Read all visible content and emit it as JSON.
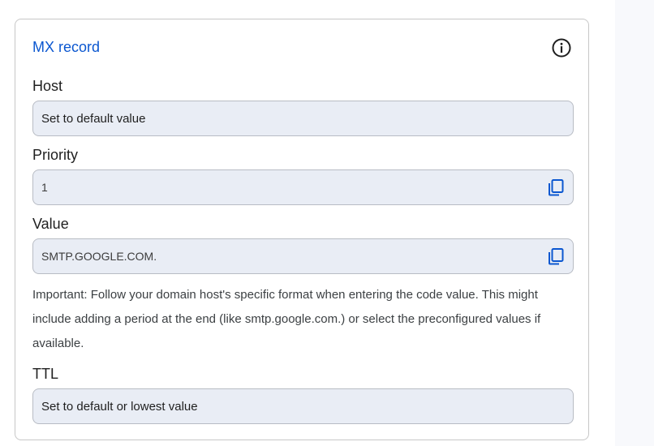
{
  "card": {
    "title": "MX record",
    "info_icon": "info-icon"
  },
  "host": {
    "label": "Host",
    "value": "Set to default value"
  },
  "priority": {
    "label": "Priority",
    "value": "1",
    "copy_icon": "copy-icon"
  },
  "value_field": {
    "label": "Value",
    "value": "SMTP.GOOGLE.COM.",
    "copy_icon": "copy-icon"
  },
  "note": "Important: Follow your domain host's specific format when entering the code value. This might include adding a period at the end (like smtp.google.com.) or select the preconfigured values if available.",
  "ttl": {
    "label": "TTL",
    "value": "Set to default or lowest value"
  },
  "colors": {
    "accent": "#0b57d0",
    "field_bg": "#e9edf5",
    "field_border": "#b8bcc4",
    "card_border": "#c7c7c7"
  }
}
